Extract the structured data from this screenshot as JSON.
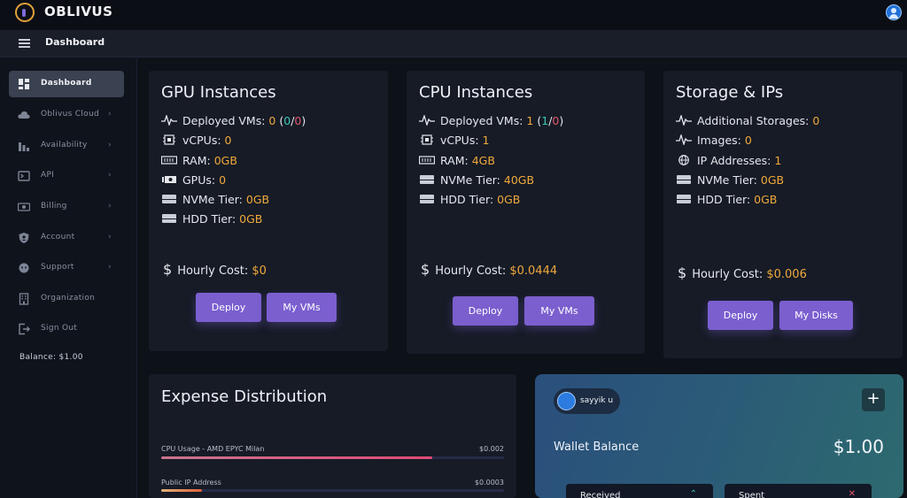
{
  "app": {
    "brand": "OBLIVUS"
  },
  "header": {
    "title": "Dashboard"
  },
  "sidebar": {
    "items": [
      {
        "label": "Dashboard",
        "icon": "dashboard-icon",
        "active": true
      },
      {
        "label": "Oblivus Cloud",
        "icon": "cloud-icon",
        "has_children": true
      },
      {
        "label": "Availability",
        "icon": "bar-chart-icon",
        "has_children": true
      },
      {
        "label": "API",
        "icon": "terminal-icon",
        "has_children": true
      },
      {
        "label": "Billing",
        "icon": "billing-icon",
        "has_children": true
      },
      {
        "label": "Account",
        "icon": "shield-icon",
        "has_children": true
      },
      {
        "label": "Support",
        "icon": "support-icon",
        "has_children": true
      },
      {
        "label": "Organization",
        "icon": "building-icon"
      },
      {
        "label": "Sign Out",
        "icon": "sign-out-icon"
      }
    ],
    "balance": "Balance: $1.00"
  },
  "gpu": {
    "title": "GPU Instances",
    "deployed_label": "Deployed VMs:",
    "deployed": "0",
    "deployed_a": "0",
    "deployed_b": "0",
    "vcpus_label": "vCPUs:",
    "vcpus": "0",
    "ram_label": "RAM:",
    "ram": "0GB",
    "gpus_label": "GPUs:",
    "gpus": "0",
    "nvme_label": "NVMe Tier:",
    "nvme": "0GB",
    "hdd_label": "HDD Tier:",
    "hdd": "0GB",
    "cost_label": "Hourly Cost:",
    "cost": "$0",
    "btn_deploy": "Deploy",
    "btn_second": "My VMs"
  },
  "cpu": {
    "title": "CPU Instances",
    "deployed_label": "Deployed VMs:",
    "deployed": "1",
    "deployed_a": "1",
    "deployed_b": "0",
    "vcpus_label": "vCPUs:",
    "vcpus": "1",
    "ram_label": "RAM:",
    "ram": "4GB",
    "nvme_label": "NVMe Tier:",
    "nvme": "40GB",
    "hdd_label": "HDD Tier:",
    "hdd": "0GB",
    "cost_label": "Hourly Cost:",
    "cost": "$0.0444",
    "btn_deploy": "Deploy",
    "btn_second": "My VMs"
  },
  "storage": {
    "title": "Storage & IPs",
    "storages_label": "Additional Storages:",
    "storages": "0",
    "images_label": "Images:",
    "images": "0",
    "ips_label": "IP Addresses:",
    "ips": "1",
    "nvme_label": "NVMe Tier:",
    "nvme": "0GB",
    "hdd_label": "HDD Tier:",
    "hdd": "0GB",
    "cost_label": "Hourly Cost:",
    "cost": "$0.006",
    "btn_deploy": "Deploy",
    "btn_second": "My Disks"
  },
  "expense": {
    "title": "Expense Distribution",
    "items": [
      {
        "label": "CPU Usage - AMD EPYC Milan",
        "value": "$0.002",
        "fraction": 0.79
      },
      {
        "label": "Public IP Address",
        "value": "$0.0003",
        "fraction": 0.12
      }
    ]
  },
  "wallet": {
    "user": "sayyik u",
    "label": "Wallet Balance",
    "amount": "$1.00",
    "received": "Received",
    "spent": "Spent"
  },
  "colors": {
    "accent": "#7b5fcf",
    "value": "#f0a93b",
    "teal": "#3bc6b6",
    "red": "#e4566b"
  }
}
